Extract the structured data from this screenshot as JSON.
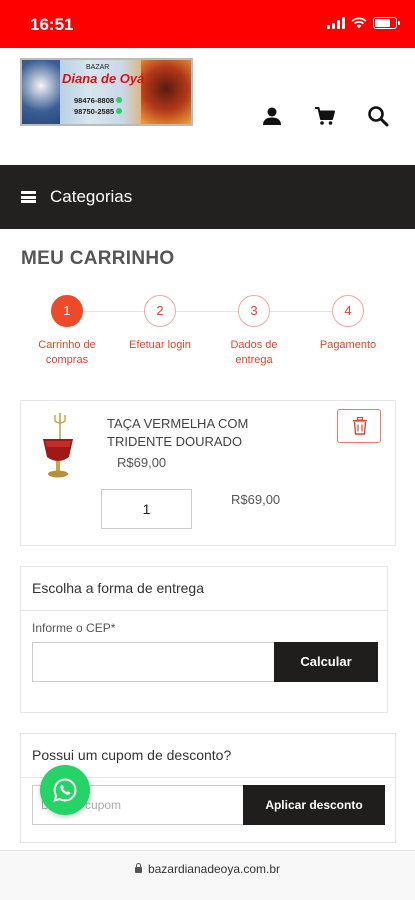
{
  "status_bar": {
    "time": "16:51"
  },
  "logo": {
    "small_text": "BAZAR",
    "brand": "Diana de Oyá",
    "phone_1": "98476-8808",
    "phone_2": "98750-2585"
  },
  "header": {
    "icons": [
      "user-icon",
      "cart-icon",
      "search-icon"
    ]
  },
  "categories": {
    "label": "Categorias"
  },
  "page": {
    "title": "MEU CARRINHO"
  },
  "steps": [
    {
      "number": "1",
      "line1": "Carrinho de",
      "line2": "compras",
      "active": true
    },
    {
      "number": "2",
      "line1": "Efetuar login",
      "line2": "",
      "active": false
    },
    {
      "number": "3",
      "line1": "Dados de",
      "line2": "entrega",
      "active": false
    },
    {
      "number": "4",
      "line1": "Pagamento",
      "line2": "",
      "active": false
    }
  ],
  "cart_item": {
    "name_line1": "TAÇA VERMELHA COM",
    "name_line2": "TRIDENTE DOURADO",
    "unit_price": "R$69,00",
    "quantity": "1",
    "subtotal": "R$69,00"
  },
  "shipping": {
    "heading": "Escolha a forma de entrega",
    "cep_label": "Informe o CEP*",
    "cep_value": "",
    "button": "Calcular"
  },
  "coupon": {
    "heading": "Possui um cupom de desconto?",
    "placeholder": "Digite o cupom",
    "button": "Aplicar desconto"
  },
  "browser": {
    "url": "bazardianadeoya.com.br"
  },
  "colors": {
    "status_bar": "#ff0000",
    "accent": "#ec4a28",
    "dark": "#232020",
    "whatsapp": "#25d366"
  }
}
